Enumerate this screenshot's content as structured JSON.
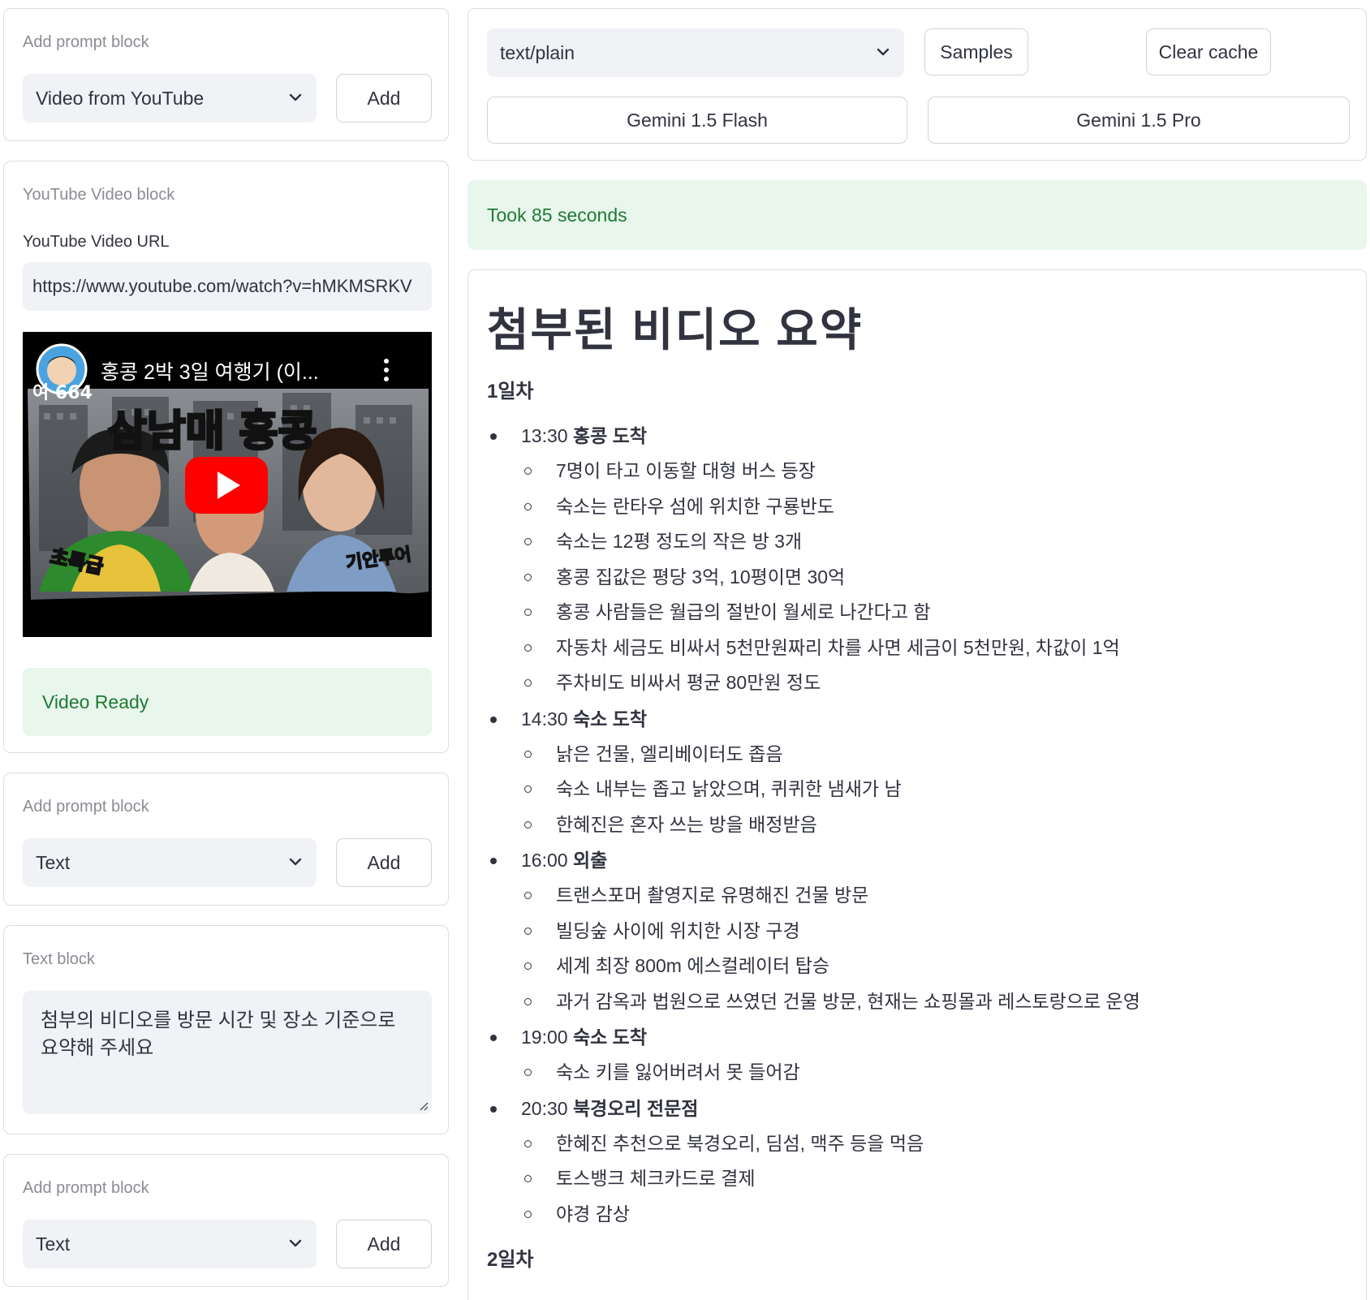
{
  "left": {
    "add_block_1": {
      "label": "Add prompt block",
      "selected": "Video from YouTube",
      "add_label": "Add"
    },
    "youtube_block": {
      "label": "YouTube Video block",
      "url_label": "YouTube Video URL",
      "url_value": "https://www.youtube.com/watch?v=hMKMSRKV",
      "video_title": "홍콩 2박 3일 여행기 (이...",
      "thumb_text_main": "삼남매 홍콩",
      "thumb_text_left": "초특급",
      "thumb_text_right": "기안투어",
      "thumb_corner": "여 664",
      "status": "Video Ready"
    },
    "add_block_2": {
      "label": "Add prompt block",
      "selected": "Text",
      "add_label": "Add"
    },
    "text_block": {
      "label": "Text block",
      "value": "첨부의 비디오를 방문 시간 및 장소 기준으로 요약해 주세요"
    },
    "add_block_3": {
      "label": "Add prompt block",
      "selected": "Text",
      "add_label": "Add"
    }
  },
  "right": {
    "mime_select": "text/plain",
    "samples_label": "Samples",
    "clear_cache_label": "Clear cache",
    "model_flash_label": "Gemini 1.5 Flash",
    "model_pro_label": "Gemini 1.5 Pro",
    "took": "Took 85 seconds"
  },
  "summary": {
    "title": "첨부된 비디오 요약",
    "day1": "1일차",
    "events": [
      {
        "time": "13:30",
        "title": "홍콩 도착",
        "items": [
          "7명이 타고 이동할 대형 버스 등장",
          "숙소는 란타우 섬에 위치한 구룡반도",
          "숙소는 12평 정도의 작은 방 3개",
          "홍콩 집값은 평당 3억, 10평이면 30억",
          "홍콩 사람들은 월급의 절반이 월세로 나간다고 함",
          "자동차 세금도 비싸서 5천만원짜리 차를 사면 세금이 5천만원, 차값이 1억",
          "주차비도 비싸서 평균 80만원 정도"
        ]
      },
      {
        "time": "14:30",
        "title": "숙소 도착",
        "items": [
          "낡은 건물, 엘리베이터도 좁음",
          "숙소 내부는 좁고 낡았으며, 퀴퀴한 냄새가 남",
          "한혜진은 혼자 쓰는 방을 배정받음"
        ]
      },
      {
        "time": "16:00",
        "title": "외출",
        "items": [
          "트랜스포머 촬영지로 유명해진 건물 방문",
          "빌딩숲 사이에 위치한 시장 구경",
          "세계 최장 800m 에스컬레이터 탑승",
          "과거 감옥과 법원으로 쓰였던 건물 방문, 현재는 쇼핑몰과 레스토랑으로 운영"
        ]
      },
      {
        "time": "19:00",
        "title": "숙소 도착",
        "items": [
          "숙소 키를 잃어버려서 못 들어감"
        ]
      },
      {
        "time": "20:30",
        "title": "북경오리 전문점",
        "items": [
          "한혜진 추천으로 북경오리, 딤섬, 맥주 등을 먹음",
          "토스뱅크 체크카드로 결제",
          "야경 감상"
        ]
      }
    ],
    "day2": "2일차"
  }
}
